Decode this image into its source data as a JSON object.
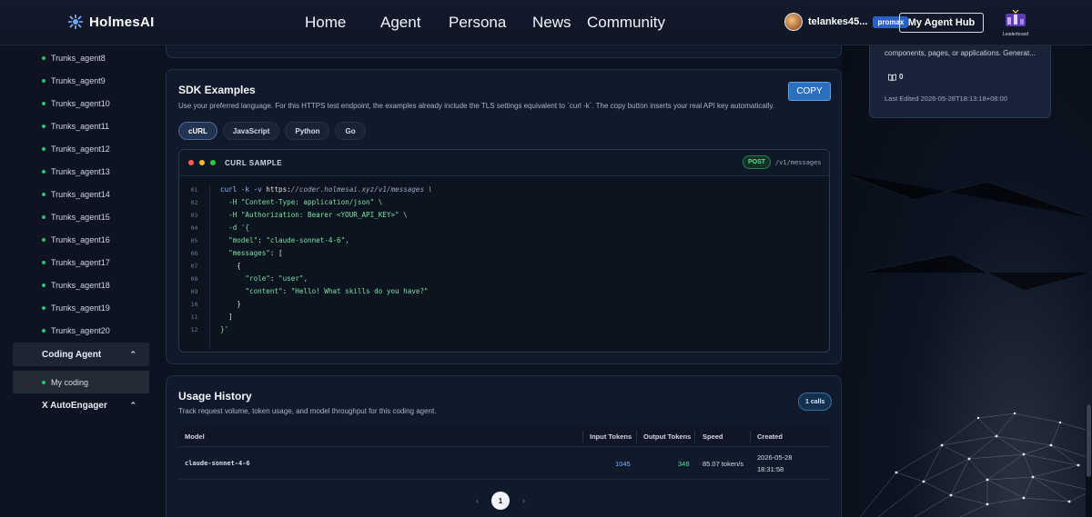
{
  "brand": {
    "name": "HolmesAI"
  },
  "nav": {
    "home": "Home",
    "agent": "Agent",
    "persona": "Persona",
    "news": "News",
    "community": "Community"
  },
  "user": {
    "name": "telankes45...",
    "badge": "promax",
    "agent_hub_label": "My Agent Hub",
    "leaderboard_label": "Leaderboard"
  },
  "sidebar": {
    "trunks": [
      "Trunks_agent8",
      "Trunks_agent9",
      "Trunks_agent10",
      "Trunks_agent11",
      "Trunks_agent12",
      "Trunks_agent13",
      "Trunks_agent14",
      "Trunks_agent15",
      "Trunks_agent16",
      "Trunks_agent17",
      "Trunks_agent18",
      "Trunks_agent19",
      "Trunks_agent20"
    ],
    "coding_group": "Coding Agent",
    "coding_sub": "My coding",
    "autoengager_group": "X AutoEngager"
  },
  "sdk": {
    "title": "SDK Examples",
    "description": "Use your preferred language. For this HTTPS test endpoint, the examples already include the TLS settings equivalent to `curl -k`. The copy button inserts your real API key automatically.",
    "copy_label": "COPY",
    "tabs": [
      "cURL",
      "JavaScript",
      "Python",
      "Go"
    ],
    "active_tab": "cURL",
    "panel_title": "CURL SAMPLE",
    "method": "POST",
    "endpoint": "/v1/messages",
    "code_lines": [
      {
        "n": "01"
      },
      {
        "n": "02"
      },
      {
        "n": "03"
      },
      {
        "n": "04"
      },
      {
        "n": "05"
      },
      {
        "n": "06"
      },
      {
        "n": "07"
      },
      {
        "n": "08"
      },
      {
        "n": "09"
      },
      {
        "n": "10"
      },
      {
        "n": "11"
      },
      {
        "n": "12"
      }
    ],
    "code": {
      "l1_cmd": "curl -k -v",
      "l1_https": "https:",
      "l1_url": "//coder.holmesai.xyz/v1/messages \\",
      "l2": "  -H \"Content-Type: application/json\" \\",
      "l3": "  -H \"Authorization: Bearer <YOUR_API_KEY>\" \\",
      "l4": "  -d '{",
      "l5_key": "  \"model\"",
      "l5_val": "\"claude-sonnet-4-6\",",
      "l6_key": "  \"messages\"",
      "l6_rest": ": [",
      "l7": "    {",
      "l8_key": "      \"role\"",
      "l8_val": "\"user\",",
      "l9_key": "      \"content\"",
      "l9_val": "\"Hello! What skills do you have?\"",
      "l10": "    }",
      "l11": "  ]",
      "l12": "}'"
    }
  },
  "usage": {
    "title": "Usage History",
    "description": "Track request volume, token usage, and model throughput for this coding agent.",
    "calls_badge": "1 calls",
    "columns": [
      "Model",
      "Input Tokens",
      "Output Tokens",
      "Speed",
      "Created"
    ],
    "rows": [
      {
        "model": "claude-sonnet-4-6",
        "input_tokens": "1045",
        "output_tokens": "348",
        "speed": "85.07 token/s",
        "created_date": "2026-05-28",
        "created_time": "18:31:58"
      }
    ],
    "page": "1"
  },
  "side_card": {
    "description": "components, pages, or applications. Generat...",
    "count": "0",
    "last_edited": "Last Edited 2026-05-28T18:13:18+08:00"
  },
  "colors": {
    "accent": "#2c6fbf",
    "online_dot": "#2fbf71",
    "post_green": "#50e08f"
  }
}
